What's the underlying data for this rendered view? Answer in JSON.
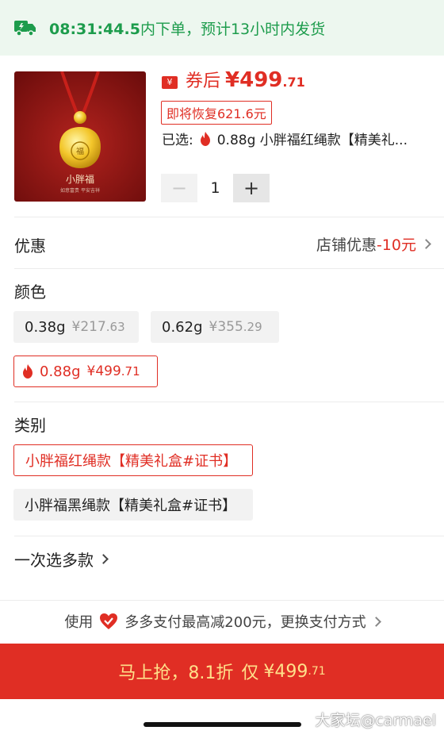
{
  "banner": {
    "time": "08:31:44.5",
    "message": "内下单，预计13小时内发货"
  },
  "product": {
    "pendant_text": "小胖福",
    "pendant_sub": "如意富贵 平安吉祥"
  },
  "price": {
    "coupon_icon": "¥",
    "label": "券后",
    "main": "¥499",
    "decimal": ".71"
  },
  "restore_tag": "即将恢复621.6元",
  "selected": {
    "prefix": "已选:",
    "text": "0.88g 小胖福红绳款【精美礼..."
  },
  "stepper": {
    "minus": "−",
    "qty": "1",
    "plus": "+"
  },
  "promo": {
    "label": "优惠",
    "right_text": "店铺优惠",
    "amount": "-10元"
  },
  "color": {
    "label": "颜色",
    "options": [
      {
        "name": "0.38g",
        "price": "¥217",
        "dec": ".63",
        "selected": false
      },
      {
        "name": "0.62g",
        "price": "¥355",
        "dec": ".29",
        "selected": false
      },
      {
        "name": "0.88g",
        "price": "¥499",
        "dec": ".71",
        "selected": true
      }
    ]
  },
  "category": {
    "label": "类别",
    "options": [
      {
        "name": "小胖福红绳款【精美礼盒#证书】",
        "selected": true
      },
      {
        "name": "小胖福黑绳款【精美礼盒#证书】",
        "selected": false
      }
    ]
  },
  "multi_select": "一次选多款",
  "payment": {
    "prefix": "使用",
    "text": "多多支付最高减200元，更换支付方式"
  },
  "buy": {
    "text": "马上抢，8.1折",
    "only": "仅",
    "price": "¥499",
    "decimal": ".71"
  },
  "watermark": "大家坛@carmael",
  "colors": {
    "accent": "#e02e24",
    "green": "#1d9c4c",
    "banner_bg": "#edf7ef",
    "gold": "#ffe08a"
  }
}
